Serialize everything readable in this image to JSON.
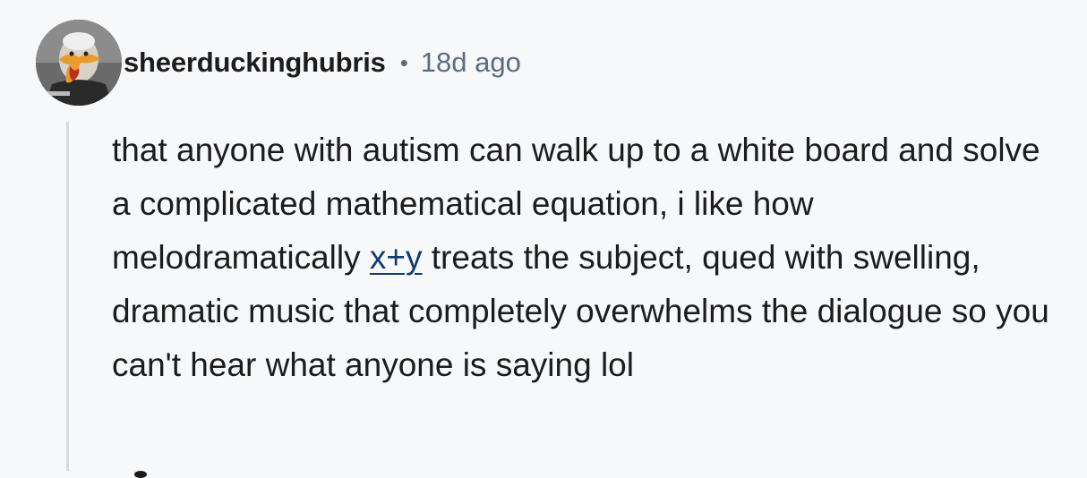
{
  "comment": {
    "username": "sheerduckinghubris",
    "separator": "•",
    "timestamp": "18d ago",
    "avatar_icon": "duck-avatar-icon",
    "body_part1": "that anyone with autism can walk up to a white board and solve a complicated mathematical equation, i like how melodramatically ",
    "link_text": "x+y",
    "body_part2": " treats the subject, qued with swelling, dramatic music that completely overwhelms the dialogue so you can't hear what anyone is saying lol"
  },
  "colors": {
    "background": "#f7f8fa",
    "text": "#1c1c1c",
    "meta": "#5a6c80",
    "link": "#123b6e",
    "thread_line": "#d7dbe0"
  }
}
